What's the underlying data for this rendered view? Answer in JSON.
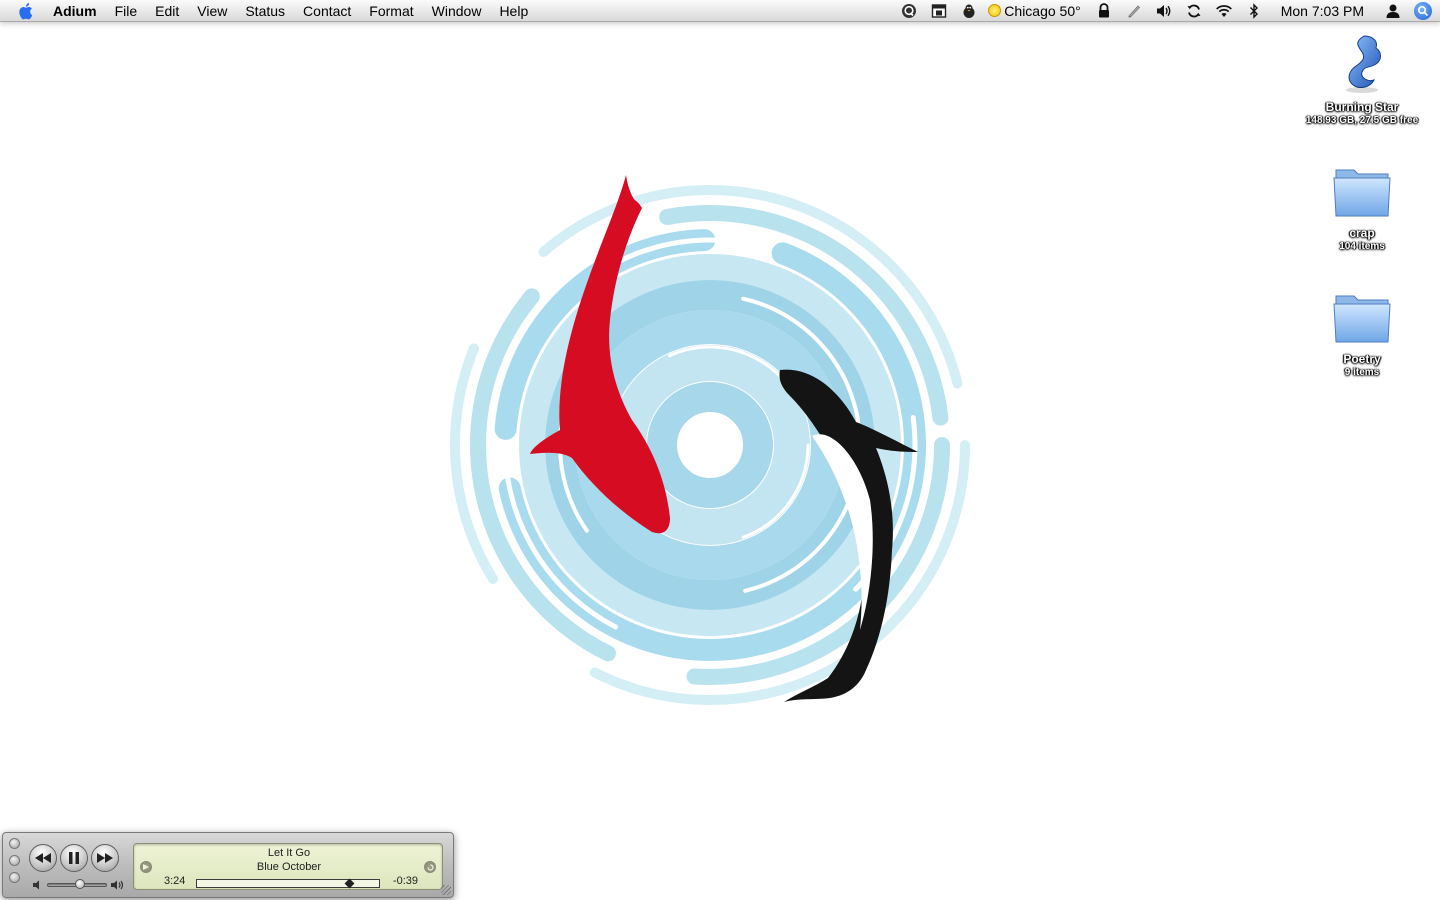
{
  "menubar": {
    "app_name": "Adium",
    "menus": [
      "File",
      "Edit",
      "View",
      "Status",
      "Contact",
      "Format",
      "Window",
      "Help"
    ],
    "status_items": [
      {
        "icon": "quicksilver-icon"
      },
      {
        "icon": "ical-icon"
      },
      {
        "icon": "adium-duck-icon"
      },
      {
        "icon": "weather-sun-icon"
      },
      {
        "icon": "lock-icon"
      },
      {
        "icon": "script-pen-icon"
      },
      {
        "icon": "volume-icon"
      },
      {
        "icon": "sync-icon"
      },
      {
        "icon": "wifi-icon"
      },
      {
        "icon": "bluetooth-icon"
      }
    ],
    "weather_text": "Chicago 50°",
    "clock": "Mon 7:03 PM",
    "user_icon": "user-icon",
    "spotlight_icon": "spotlight-icon"
  },
  "desktop_icons": [
    {
      "name": "Burning Star",
      "info": "148.93 GB, 27.5 GB free",
      "icon": "hard-drive-icon"
    },
    {
      "name": "crap",
      "info": "104 items",
      "icon": "folder-icon"
    },
    {
      "name": "Poetry",
      "info": "9 items",
      "icon": "folder-icon"
    }
  ],
  "mini_player": {
    "song_title": "Let It Go",
    "artist": "Blue October",
    "elapsed": "3:24",
    "remaining": "-0:39",
    "progress_fraction": 0.84,
    "volume_fraction": 0.55,
    "controls": [
      "previous-icon",
      "pause-icon",
      "next-icon"
    ]
  },
  "colors": {
    "water_light": "#c8e8f2",
    "water_mid": "#9fd4e8",
    "koi_red": "#d60d22",
    "koi_black": "#141414",
    "lcd_bg": "#e6edcb"
  }
}
